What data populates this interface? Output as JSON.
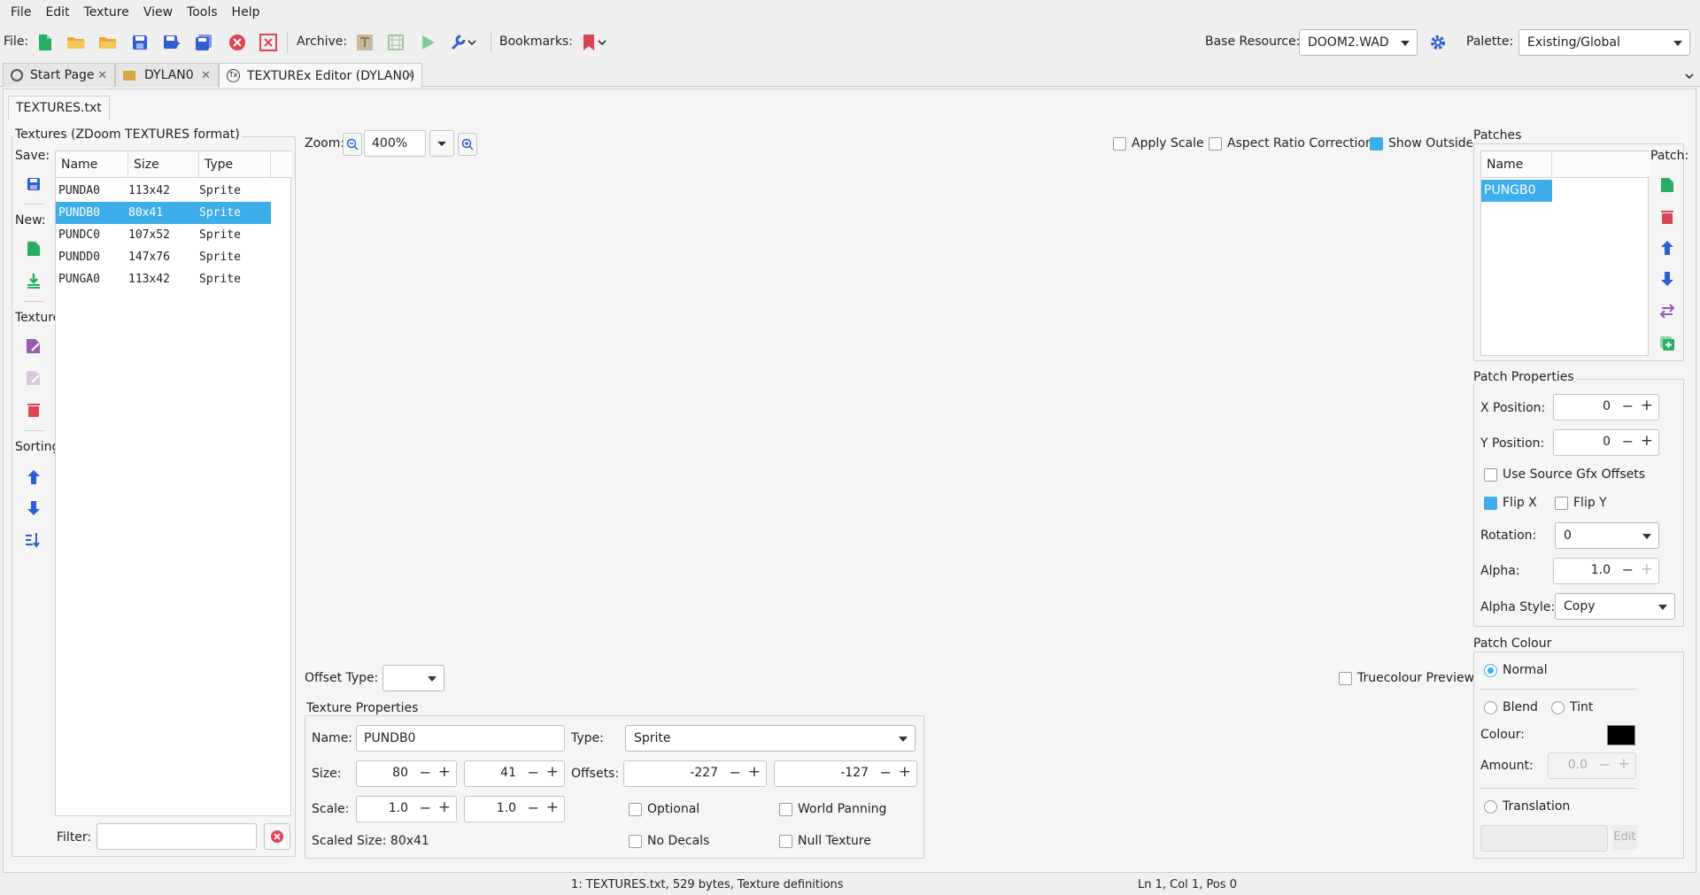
{
  "menu": [
    "File",
    "Edit",
    "Texture",
    "View",
    "Tools",
    "Help"
  ],
  "toolbar": {
    "file_label": "File:",
    "archive_label": "Archive:",
    "bookmarks_label": "Bookmarks:",
    "base_resource_label": "Base Resource:",
    "base_resource_value": "DOOM2.WAD",
    "palette_label": "Palette:",
    "palette_value": "Existing/Global"
  },
  "tabs": [
    {
      "label": "Start Page"
    },
    {
      "label": "DYLAN0"
    },
    {
      "label": "TEXTUREx Editor (DYLAN0)"
    }
  ],
  "subtab": "TEXTURES.txt",
  "textures": {
    "group_label": "Textures (ZDoom TEXTURES format)",
    "save_label": "Save:",
    "new_label": "New:",
    "texture_label": "Texture",
    "sorting_label": "Sorting",
    "columns": [
      "Name",
      "Size",
      "Type"
    ],
    "rows": [
      {
        "name": "PUNDA0",
        "size": "113x42",
        "type": "Sprite"
      },
      {
        "name": "PUNDB0",
        "size": "80x41",
        "type": "Sprite"
      },
      {
        "name": "PUNDC0",
        "size": "107x52",
        "type": "Sprite"
      },
      {
        "name": "PUNDD0",
        "size": "147x76",
        "type": "Sprite"
      },
      {
        "name": "PUNGA0",
        "size": "113x42",
        "type": "Sprite"
      }
    ],
    "selected_index": 1,
    "filter_label": "Filter:",
    "filter_value": ""
  },
  "canvas": {
    "zoom_label": "Zoom:",
    "zoom_value": "400%",
    "apply_scale": "Apply Scale",
    "aspect_ratio": "Aspect Ratio Correction",
    "show_outside": "Show Outside",
    "offset_type_label": "Offset Type:",
    "truecolour_preview": "Truecolour Preview"
  },
  "texture_props": {
    "group_label": "Texture Properties",
    "name_label": "Name:",
    "name_value": "PUNDB0",
    "type_label": "Type:",
    "type_value": "Sprite",
    "size_label": "Size:",
    "width": "80",
    "height": "41",
    "offsets_label": "Offsets:",
    "offset_x": "-227",
    "offset_y": "-127",
    "scale_label": "Scale:",
    "scale_x": "1.0",
    "scale_y": "1.0",
    "optional": "Optional",
    "world_panning": "World Panning",
    "no_decals": "No Decals",
    "null_texture": "Null Texture",
    "scaled_size": "Scaled Size: 80x41"
  },
  "patches": {
    "group_label": "Patches",
    "column": "Name",
    "items": [
      "PUNGB0"
    ],
    "patch_label": "Patch:"
  },
  "patch_props": {
    "group_label": "Patch Properties",
    "x_label": "X Position:",
    "x_value": "0",
    "y_label": "Y Position:",
    "y_value": "0",
    "use_source_offsets": "Use Source Gfx Offsets",
    "flip_x": "Flip X",
    "flip_y": "Flip Y",
    "rotation_label": "Rotation:",
    "rotation_value": "0",
    "alpha_label": "Alpha:",
    "alpha_value": "1.0",
    "alpha_style_label": "Alpha Style:",
    "alpha_style_value": "Copy"
  },
  "patch_colour": {
    "group_label": "Patch Colour",
    "normal": "Normal",
    "blend": "Blend",
    "tint": "Tint",
    "colour_label": "Colour:",
    "colour_value": "#000000",
    "amount_label": "Amount:",
    "amount_value": "0.0",
    "translation": "Translation",
    "edit_button": "Edit"
  },
  "status": {
    "left": "1: TEXTURES.txt, 529 bytes, Texture definitions",
    "right": "Ln 1, Col 1, Pos 0"
  },
  "colors": {
    "accent": "#3daee9",
    "green": "#27ae60",
    "red": "#da4453",
    "blue": "#2f5ed4",
    "purple": "#9b59b6"
  }
}
